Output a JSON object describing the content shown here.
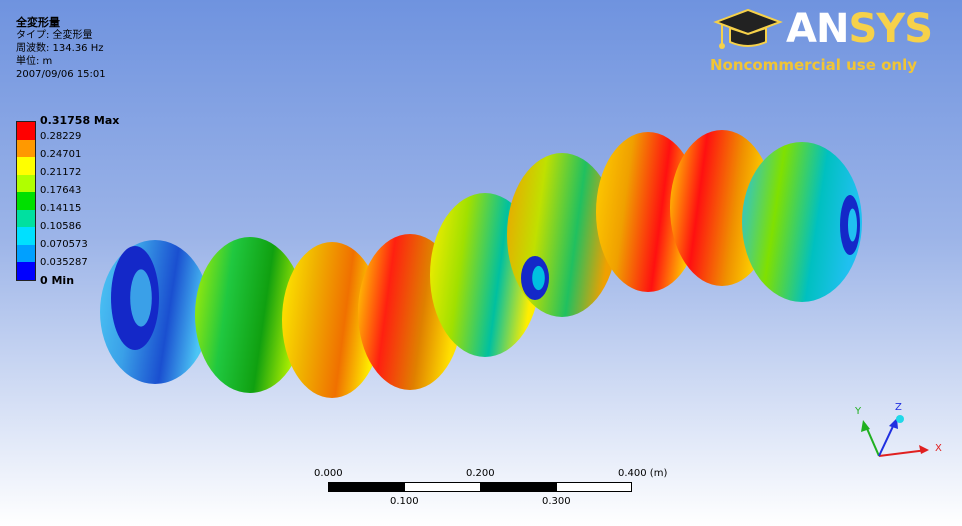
{
  "info": {
    "title": "全変形量",
    "type_line": "タイプ: 全変形量",
    "frequency_line": "周波数: 134.36 Hz",
    "unit_line": "単位: m",
    "date_line": "2007/09/06 15:01"
  },
  "legend": {
    "max_label": "0.31758 Max",
    "min_label": "0 Min",
    "levels": [
      "0.28229",
      "0.24701",
      "0.21172",
      "0.17643",
      "0.14115",
      "0.10586",
      "0.070573",
      "0.035287"
    ],
    "colors": [
      "#ff0000",
      "#ff9900",
      "#ffff00",
      "#b0ff00",
      "#00e000",
      "#00e0a0",
      "#00e0ff",
      "#00a0ff",
      "#0000ff"
    ]
  },
  "logo": {
    "brand_a": "AN",
    "brand_b": "SYS",
    "tagline": "Noncommercial use only"
  },
  "scale_bar": {
    "top_ticks": [
      "0.000",
      "0.200",
      "0.400 (m)"
    ],
    "bottom_ticks": [
      "0.100",
      "0.300"
    ]
  },
  "axes": {
    "x": "X",
    "y": "Y",
    "z": "Z",
    "colors": {
      "x": "#e02020",
      "y": "#20b020",
      "z": "#2030e0"
    }
  },
  "model": {
    "lobes": [
      {
        "fill": "#3aa0e8",
        "mid": "#1a4fd0",
        "rim": "#4cc6f5"
      },
      {
        "fill": "#20c840",
        "mid": "#10a010",
        "rim": "#b0f000"
      },
      {
        "fill": "#f0b000",
        "mid": "#f07000",
        "rim": "#ffee00"
      },
      {
        "fill": "#ff2010",
        "mid": "#e08000",
        "rim": "#ffe000"
      },
      {
        "fill": "#a0e000",
        "mid": "#00c0a0",
        "rim": "#ffee00"
      },
      {
        "fill": "#c0e000",
        "mid": "#20c060",
        "rim": "#f0a000"
      },
      {
        "fill": "#f0a000",
        "mid": "#ff1010",
        "rim": "#ffd000"
      },
      {
        "fill": "#ff1010",
        "mid": "#f09000",
        "rim": "#ffe000"
      },
      {
        "fill": "#80e000",
        "mid": "#00c0c0",
        "rim": "#20c0f0"
      }
    ]
  }
}
